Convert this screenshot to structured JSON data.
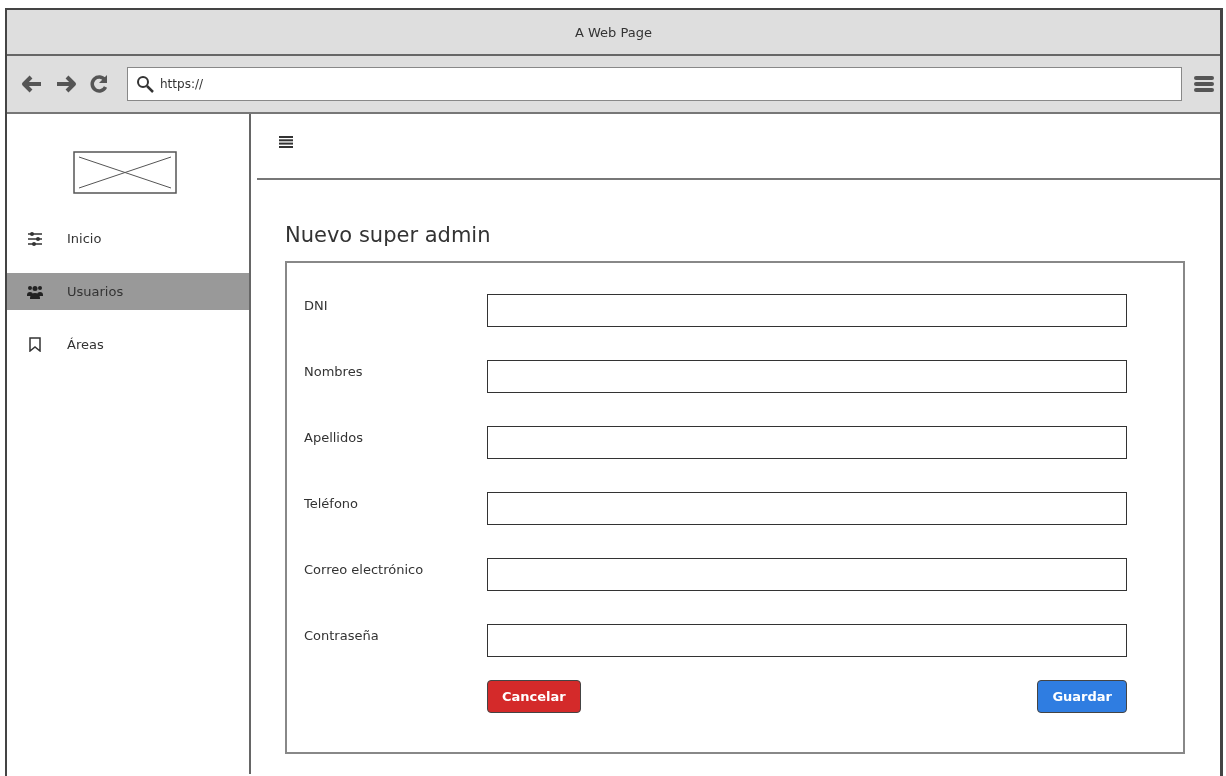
{
  "window": {
    "title": "A Web Page"
  },
  "address_bar": {
    "value": "https://"
  },
  "sidebar": {
    "items": [
      {
        "label": "Inicio",
        "kind": "sliders",
        "selected": false
      },
      {
        "label": "Usuarios",
        "kind": "users",
        "selected": true
      },
      {
        "label": "Áreas",
        "kind": "bookmark",
        "selected": false
      }
    ]
  },
  "page": {
    "title": "Nuevo super admin",
    "fields": [
      {
        "label": "DNI"
      },
      {
        "label": "Nombres"
      },
      {
        "label": "Apellidos"
      },
      {
        "label": "Teléfono"
      },
      {
        "label": "Correo electrónico"
      },
      {
        "label": "Contraseña"
      }
    ],
    "buttons": [
      {
        "label": "Cancelar",
        "kind": "cancel"
      },
      {
        "label": "Guardar",
        "kind": "save"
      }
    ]
  }
}
